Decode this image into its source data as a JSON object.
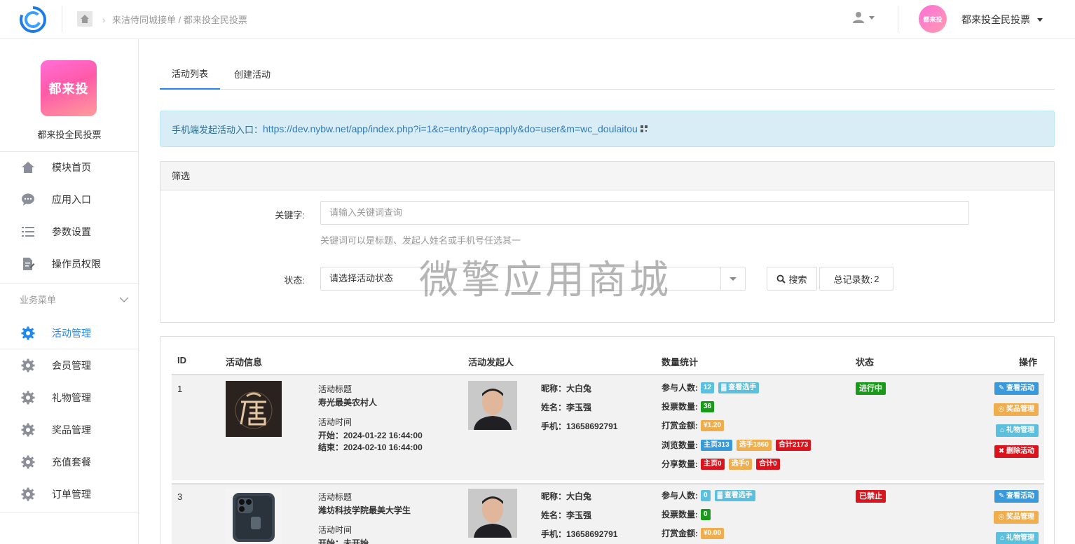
{
  "header": {
    "breadcrumb_1": "来洁侍同城接单",
    "breadcrumb_sep": "/",
    "breadcrumb_2": "都来投全民投票",
    "avatar_text": "都来投",
    "account_name": "都来投全民投票"
  },
  "sidebar": {
    "brand_logo_text": "都来投",
    "brand_name": "都来投全民投票",
    "items": [
      {
        "label": "模块首页",
        "icon": "home-icon"
      },
      {
        "label": "应用入口",
        "icon": "chat-bubble-icon"
      },
      {
        "label": "参数设置",
        "icon": "list-icon"
      },
      {
        "label": "操作员权限",
        "icon": "document-edit-icon"
      }
    ],
    "group_label": "业务菜单",
    "business_items": [
      {
        "label": "活动管理",
        "icon": "gear-icon",
        "active": true
      },
      {
        "label": "会员管理",
        "icon": "gear-icon"
      },
      {
        "label": "礼物管理",
        "icon": "gear-icon"
      },
      {
        "label": "奖品管理",
        "icon": "gear-icon"
      },
      {
        "label": "充值套餐",
        "icon": "gear-icon"
      },
      {
        "label": "订单管理",
        "icon": "gear-icon"
      }
    ]
  },
  "tabs": [
    {
      "label": "活动列表",
      "active": true
    },
    {
      "label": "创建活动",
      "active": false
    }
  ],
  "alert": {
    "prefix": "手机端发起活动入口：",
    "url": "https://dev.nybw.net/app/index.php?i=1&c=entry&op=apply&do=user&m=wc_doulaitou"
  },
  "filter": {
    "title": "筛选",
    "keyword_label": "关键字:",
    "keyword_placeholder": "请输入关键词查询",
    "keyword_help": "关键词可以是标题、发起人姓名或手机号任选其一",
    "status_label": "状态:",
    "status_value": "请选择活动状态",
    "search_button": "搜索",
    "total_label": "总记录数:",
    "total_count": "2"
  },
  "watermark": "微擎应用商城",
  "table": {
    "headers": [
      "ID",
      "活动信息",
      "活动发起人",
      "数量统计",
      "状态",
      "操作"
    ],
    "rows": [
      {
        "id": "1",
        "title_label": "活动标题",
        "title": "寿光最美农村人",
        "time_label": "活动时间",
        "start": "开始：2024-01-22 16:44:00",
        "end": "结束：2024-02-10 16:44:00",
        "nickname": "昵称：大白兔",
        "name": "姓名：李玉强",
        "phone": "手机：13658692791",
        "participants_label": "参与人数:",
        "participants": "12",
        "view_players": "查看选手",
        "votes_label": "投票数量:",
        "votes": "36",
        "reward_label": "打赏金额:",
        "reward": "¥1.20",
        "views_label": "浏览数量:",
        "views_home": "主页313",
        "views_player": "选手1860",
        "views_total": "合计2173",
        "shares_label": "分享数量:",
        "shares_home": "主页0",
        "shares_player": "选手0",
        "shares_total": "合计0",
        "status": "进行中",
        "status_color": "#1a9a1a",
        "ops": [
          "查看活动",
          "奖品管理",
          "礼物管理",
          "删除活动"
        ]
      },
      {
        "id": "3",
        "title_label": "活动标题",
        "title": "潍坊科技学院最美大学生",
        "time_label": "活动时间",
        "start": "开始：未开始",
        "nickname": "昵称：大白兔",
        "name": "姓名：李玉强",
        "phone": "手机：13658692791",
        "participants_label": "参与人数:",
        "participants": "0",
        "view_players": "查看选手",
        "votes_label": "投票数量:",
        "votes": "0",
        "reward_label": "打赏金额:",
        "reward": "¥0.00",
        "status": "已禁止",
        "status_color": "#d9141c",
        "ops": [
          "查看活动",
          "奖品管理",
          "礼物管理"
        ]
      }
    ]
  }
}
